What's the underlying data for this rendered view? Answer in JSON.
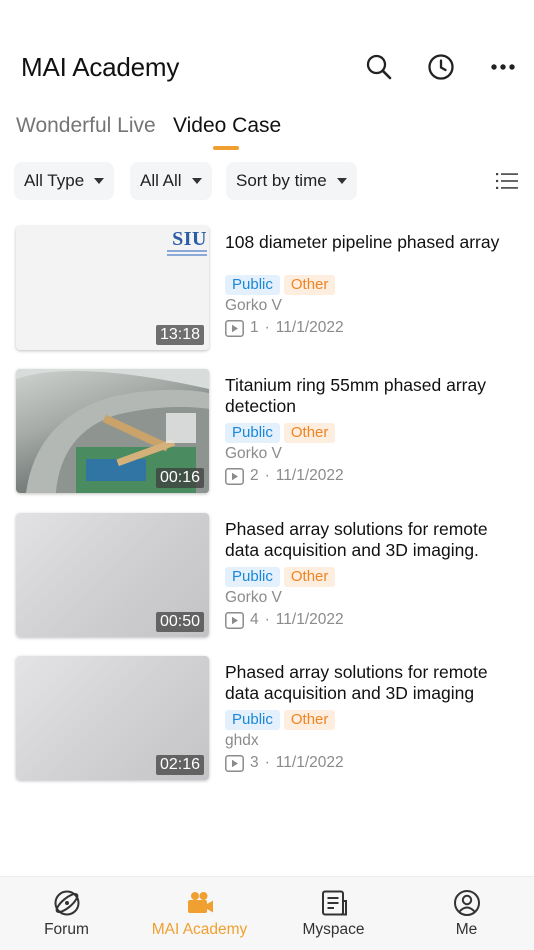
{
  "header": {
    "title": "MAI Academy",
    "icons": [
      "search-icon",
      "history-clock-icon",
      "more-dots-icon"
    ]
  },
  "tabs": [
    {
      "label": "Wonderful Live",
      "active": false
    },
    {
      "label": "Video Case",
      "active": true
    }
  ],
  "accent_color": "#f0a030",
  "filters": {
    "type": "All Type",
    "category": "All All",
    "sort": "Sort by time"
  },
  "videos": [
    {
      "title": "108 diameter pipeline phased array",
      "duration": "13:18",
      "tags": [
        "Public",
        "Other"
      ],
      "author": "Gorko V",
      "plays": "1",
      "date": "11/1/2022",
      "thumb_text": "SIU"
    },
    {
      "title": "Titanium ring 55mm phased array detection",
      "duration": "00:16",
      "tags": [
        "Public",
        "Other"
      ],
      "author": "Gorko V",
      "plays": "2",
      "date": "11/1/2022"
    },
    {
      "title": "Phased array solutions for remote data acquisition and 3D imaging.",
      "duration": "00:50",
      "tags": [
        "Public",
        "Other"
      ],
      "author": "Gorko V",
      "plays": "4",
      "date": "11/1/2022"
    },
    {
      "title": "Phased array solutions for remote data acquisition and 3D imaging",
      "duration": "02:16",
      "tags": [
        "Public",
        "Other"
      ],
      "author": "ghdx",
      "plays": "3",
      "date": "11/1/2022"
    }
  ],
  "meta_separator": "·",
  "bottom_nav": [
    {
      "label": "Forum",
      "icon": "planet-icon",
      "active": false
    },
    {
      "label": "MAI Academy",
      "icon": "video-camera-icon",
      "active": true
    },
    {
      "label": "Myspace",
      "icon": "document-icon",
      "active": false
    },
    {
      "label": "Me",
      "icon": "user-icon",
      "active": false
    }
  ]
}
